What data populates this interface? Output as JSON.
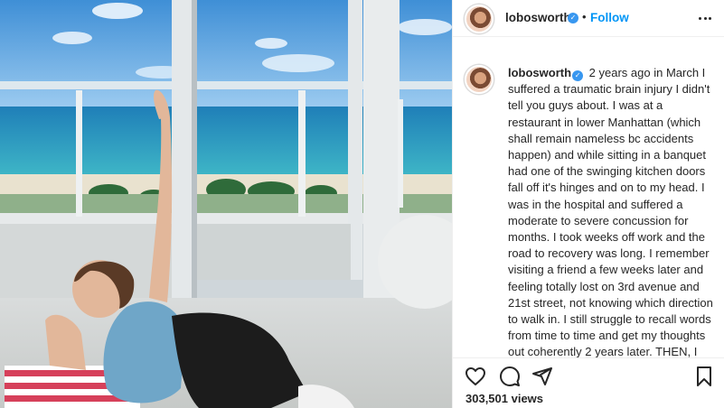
{
  "post": {
    "author": "lobosworth",
    "verified_mark": "✓",
    "separator": "•",
    "follow_label": "Follow",
    "caption_user": "lobosworth",
    "caption_text": "2 years ago in March I suffered a traumatic brain injury I didn't tell you guys about. I was at a restaurant in lower Manhattan (which shall remain nameless bc accidents happen) and while sitting in a banquet had one of the swinging kitchen doors fall off it's hinges and on to my head. I was in the hospital and suffered a moderate to severe concussion for months. I took weeks off work and the road to recovery was long. I remember visiting a friend a few weeks later and feeling totally lost on 3rd avenue and 21st street, not knowing which direction to walk in. I still struggle to recall words from time to time and get my thoughts out coherently 2 years later. THEN, I found out I had mononucleosis on top of it",
    "views": "303,501 views"
  },
  "icons": {
    "more": "more-options-icon",
    "like": "heart-icon",
    "comment": "comment-icon",
    "share": "share-icon",
    "save": "bookmark-icon"
  },
  "colors": {
    "link_blue": "#0095f6",
    "verified_blue": "#3897f0",
    "text": "#262626",
    "divider": "#efefef"
  }
}
